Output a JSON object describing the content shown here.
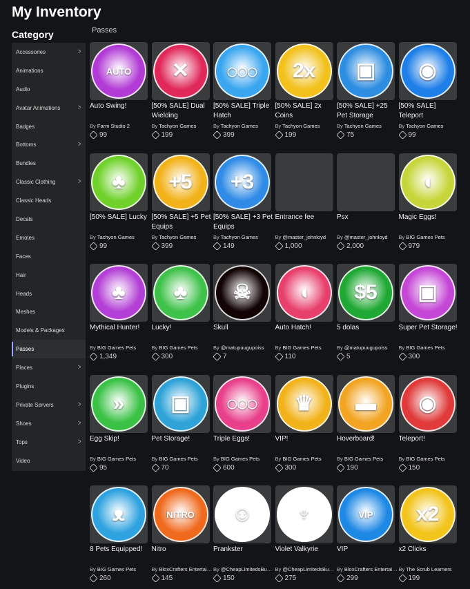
{
  "header": {
    "title": "My Inventory"
  },
  "sidebar": {
    "heading": "Category",
    "items": [
      {
        "label": "Accessories",
        "chevron": true
      },
      {
        "label": "Animations",
        "chevron": false
      },
      {
        "label": "Audio",
        "chevron": false
      },
      {
        "label": "Avatar Animations",
        "chevron": true
      },
      {
        "label": "Badges",
        "chevron": false
      },
      {
        "label": "Bottoms",
        "chevron": true
      },
      {
        "label": "Bundles",
        "chevron": false
      },
      {
        "label": "Classic Clothing",
        "chevron": true
      },
      {
        "label": "Classic Heads",
        "chevron": false
      },
      {
        "label": "Decals",
        "chevron": false
      },
      {
        "label": "Emotes",
        "chevron": false
      },
      {
        "label": "Faces",
        "chevron": false
      },
      {
        "label": "Hair",
        "chevron": false
      },
      {
        "label": "Heads",
        "chevron": false
      },
      {
        "label": "Meshes",
        "chevron": false
      },
      {
        "label": "Models & Packages",
        "chevron": false
      },
      {
        "label": "Passes",
        "chevron": false,
        "active": true
      },
      {
        "label": "Places",
        "chevron": true
      },
      {
        "label": "Plugins",
        "chevron": false
      },
      {
        "label": "Private Servers",
        "chevron": true
      },
      {
        "label": "Shoes",
        "chevron": true
      },
      {
        "label": "Tops",
        "chevron": true
      },
      {
        "label": "Video",
        "chevron": false
      }
    ]
  },
  "main": {
    "section_label": "Passes",
    "by_prefix": "By",
    "items": [
      {
        "name": "Auto Swing!",
        "creator": "Farm Studio 2",
        "price": "99",
        "icon": "sword-icon",
        "color": "#b23bd6",
        "glyph": "AUTO"
      },
      {
        "name": "[50% SALE] Dual Wielding",
        "creator": "Tachyon Games",
        "price": "199",
        "icon": "dual-swords-icon",
        "color": "#e0295a",
        "glyph": "✕"
      },
      {
        "name": "[50% SALE] Triple Hatch",
        "creator": "Tachyon Games",
        "price": "399",
        "icon": "eggs-icon",
        "color": "#3aa6f0",
        "glyph": "◯◯◯"
      },
      {
        "name": "[50% SALE] 2x Coins",
        "creator": "Tachyon Games",
        "price": "199",
        "icon": "coin-icon",
        "color": "#f2c11c",
        "glyph": "2x"
      },
      {
        "name": "[50% SALE] +25 Pet Storage",
        "creator": "Tachyon Games",
        "price": "75",
        "icon": "backpack-icon",
        "color": "#2d8de0",
        "glyph": "▣"
      },
      {
        "name": "[50% SALE] Teleport",
        "creator": "Tachyon Games",
        "price": "99",
        "icon": "teleport-icon",
        "color": "#1f7fe8",
        "glyph": "◉"
      },
      {
        "name": "[50% SALE] Lucky",
        "creator": "Tachyon Games",
        "price": "99",
        "icon": "clover-icon",
        "color": "#6fd12a",
        "glyph": "♣"
      },
      {
        "name": "[50% SALE] +5 Pet Equips",
        "creator": "Tachyon Games",
        "price": "399",
        "icon": "pet-icon",
        "color": "#f2b21a",
        "glyph": "+5"
      },
      {
        "name": "[50% SALE] +3 Pet Equips",
        "creator": "Tachyon Games",
        "price": "149",
        "icon": "pet-icon",
        "color": "#2f8be6",
        "glyph": "+3"
      },
      {
        "name": "Entrance fee",
        "creator": "@master_johnloyd",
        "price": "1,000",
        "icon": "blank-icon",
        "color": "",
        "glyph": ""
      },
      {
        "name": "Psx",
        "creator": "@master_johnloyd",
        "price": "2,000",
        "icon": "blank-icon",
        "color": "",
        "glyph": ""
      },
      {
        "name": "Magic Eggs!",
        "creator": "BIG Games Pets",
        "price": "979",
        "icon": "egg-icon",
        "color": "#c6d63a",
        "glyph": "◖"
      },
      {
        "name": "Mythical Hunter!",
        "creator": "BIG Games Pets",
        "price": "1,349",
        "icon": "clover-icon",
        "color": "#b33fd6",
        "glyph": "♣"
      },
      {
        "name": "Lucky!",
        "creator": "BIG Games Pets",
        "price": "300",
        "icon": "clover-icon",
        "color": "#3fc24a",
        "glyph": "♣"
      },
      {
        "name": "Skull",
        "creator": "@matupuugupoiss",
        "price": "7",
        "icon": "skeleton-icon",
        "color": "#120404",
        "glyph": "☠"
      },
      {
        "name": "Auto Hatch!",
        "creator": "BIG Games Pets",
        "price": "110",
        "icon": "egg-icon",
        "color": "#e8406c",
        "glyph": "◖"
      },
      {
        "name": "5 dolas",
        "creator": "@matupuugupoiss",
        "price": "5",
        "icon": "cash-icon",
        "color": "#1fa833",
        "glyph": "$5"
      },
      {
        "name": "Super Pet Storage!",
        "creator": "BIG Games Pets",
        "price": "300",
        "icon": "backpack-icon",
        "color": "#c547d6",
        "glyph": "▣"
      },
      {
        "name": "Egg Skip!",
        "creator": "BIG Games Pets",
        "price": "95",
        "icon": "fast-forward-icon",
        "color": "#3bc246",
        "glyph": "»"
      },
      {
        "name": "Pet Storage!",
        "creator": "BIG Games Pets",
        "price": "70",
        "icon": "backpack-icon",
        "color": "#2fa3d8",
        "glyph": "▣"
      },
      {
        "name": "Triple Eggs!",
        "creator": "BIG Games Pets",
        "price": "600",
        "icon": "eggs-icon",
        "color": "#e8408a",
        "glyph": "◯◯◯"
      },
      {
        "name": "VIP!",
        "creator": "BIG Games Pets",
        "price": "300",
        "icon": "crown-icon",
        "color": "#f2b21a",
        "glyph": "♛"
      },
      {
        "name": "Hoverboard!",
        "creator": "BIG Games Pets",
        "price": "190",
        "icon": "hoverboard-icon",
        "color": "#f2a422",
        "glyph": "▬"
      },
      {
        "name": "Teleport!",
        "creator": "BIG Games Pets",
        "price": "150",
        "icon": "teleport-icon",
        "color": "#e03a3a",
        "glyph": "◉"
      },
      {
        "name": "8 Pets Equipped!",
        "creator": "BIG Games Pets",
        "price": "260",
        "icon": "pet-icon",
        "color": "#2fa3e0",
        "glyph": "ᴥ"
      },
      {
        "name": "Nitro",
        "creator": "BloxCrafters Entertainment",
        "price": "145",
        "icon": "nitro-icon",
        "color": "#f06a1e",
        "glyph": "NITRO"
      },
      {
        "name": "Prankster",
        "creator": "@CheapLimitedsBuyers",
        "price": "150",
        "icon": "face-icon",
        "color": "#ffffff",
        "glyph": "☺"
      },
      {
        "name": "Violet Valkyrie",
        "creator": "@CheapLimitedsBuyers",
        "price": "275",
        "icon": "helmet-icon",
        "color": "#ffffff",
        "glyph": "♆"
      },
      {
        "name": "VIP",
        "creator": "BloxCrafters Entertainment",
        "price": "299",
        "icon": "vip-icon",
        "color": "#1e88e5",
        "glyph": "VIP"
      },
      {
        "name": "x2 Clicks",
        "creator": "The Scrub Learners",
        "price": "199",
        "icon": "cursor-icon",
        "color": "#f2c41c",
        "glyph": "x2"
      }
    ]
  }
}
